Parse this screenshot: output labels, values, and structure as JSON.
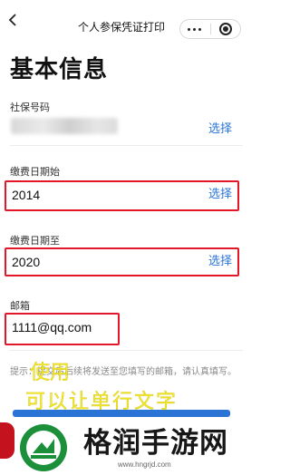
{
  "navbar": {
    "back_icon": "chevron-left-icon",
    "title": "个人参保凭证打印",
    "menu_icon": "more-dots-icon",
    "close_icon": "target-circle-icon"
  },
  "page_title": "基本信息",
  "fields": {
    "ssn": {
      "label": "社保号码",
      "action": "选择"
    },
    "start": {
      "label": "缴费日期始",
      "value": "2014",
      "action": "选择"
    },
    "end": {
      "label": "缴费日期至",
      "value": "2020",
      "action": "选择"
    },
    "email": {
      "label": "邮箱",
      "value": "1111@qq.com"
    }
  },
  "hint": "提示：提交后后续将发送至您填写的邮箱，请认真填写。",
  "overlay": {
    "line1": "使用",
    "line2": "可以让单行文字"
  },
  "banner": {
    "name": "格润手游网",
    "url": "www.hngrjd.com"
  },
  "colors": {
    "accent": "#2a74d6",
    "highlight_border": "#e3172a",
    "overlay_text": "#f3ea2c"
  }
}
